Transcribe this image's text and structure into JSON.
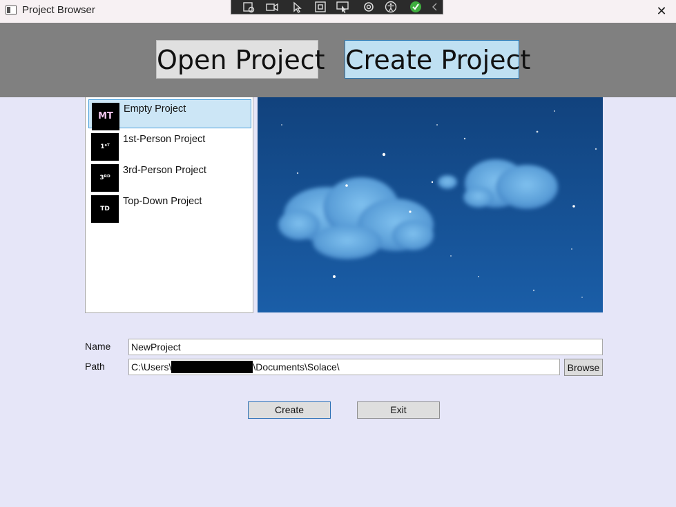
{
  "window": {
    "title": "Project Browser",
    "close_icon": "close-icon"
  },
  "dev_toolbar": {
    "icons": [
      "live-visual-tree-icon",
      "record-icon",
      "select-element-icon",
      "display-layout-adorners-icon",
      "track-focus-icon",
      "hot-reload-icon",
      "accessibility-icon",
      "check-icon",
      "collapse-icon"
    ]
  },
  "header": {
    "open_label": "Open Project",
    "create_label": "Create Project",
    "active_tab": "create"
  },
  "templates": [
    {
      "name": "Empty Project",
      "icon": "MT",
      "selected": true
    },
    {
      "name": "1st-Person Project",
      "icon": "1ˢᵀ",
      "selected": false
    },
    {
      "name": "3rd-Person Project",
      "icon": "3ᴿᴰ",
      "selected": false
    },
    {
      "name": "Top-Down Project",
      "icon": "TD",
      "selected": false
    }
  ],
  "form": {
    "name_label": "Name",
    "name_value": "NewProject",
    "path_label": "Path",
    "path_prefix": "C:\\Users\\",
    "path_suffix": "\\Documents\\Solace\\",
    "browse_label": "Browse"
  },
  "actions": {
    "create_label": "Create",
    "exit_label": "Exit"
  },
  "colors": {
    "background": "#e6e6f8",
    "header": "#808080",
    "selection": "#cce6f6",
    "accent": "#2a78b4"
  }
}
